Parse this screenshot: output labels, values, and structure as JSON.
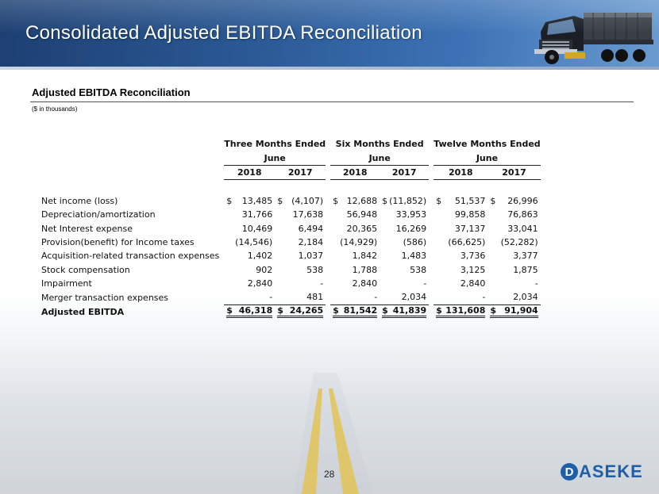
{
  "header": {
    "title": "Consolidated Adjusted EBITDA Reconciliation"
  },
  "section": {
    "title": "Adjusted EBITDA Reconciliation",
    "units": "($ in thousands)"
  },
  "table": {
    "groups": [
      {
        "line1": "Three Months Ended",
        "line2": "June"
      },
      {
        "line1": "Six Months Ended",
        "line2": "June"
      },
      {
        "line1": "Twelve Months Ended",
        "line2": "June"
      }
    ],
    "years": [
      "2018",
      "2017",
      "2018",
      "2017",
      "2018",
      "2017"
    ],
    "rows": [
      {
        "label": "Net income (loss)",
        "cells": [
          {
            "cur": "$",
            "val": "13,485"
          },
          {
            "cur": "$",
            "val": "(4,107)"
          },
          {
            "cur": "$",
            "val": "12,688"
          },
          {
            "cur": "$",
            "val": "(11,852)"
          },
          {
            "cur": "$",
            "val": "51,537"
          },
          {
            "cur": "$",
            "val": "26,996"
          }
        ]
      },
      {
        "label": "Depreciation/amortization",
        "cells": [
          {
            "cur": "",
            "val": "31,766"
          },
          {
            "cur": "",
            "val": "17,638"
          },
          {
            "cur": "",
            "val": "56,948"
          },
          {
            "cur": "",
            "val": "33,953"
          },
          {
            "cur": "",
            "val": "99,858"
          },
          {
            "cur": "",
            "val": "76,863"
          }
        ]
      },
      {
        "label": "Net Interest expense",
        "cells": [
          {
            "cur": "",
            "val": "10,469"
          },
          {
            "cur": "",
            "val": "6,494"
          },
          {
            "cur": "",
            "val": "20,365"
          },
          {
            "cur": "",
            "val": "16,269"
          },
          {
            "cur": "",
            "val": "37,137"
          },
          {
            "cur": "",
            "val": "33,041"
          }
        ]
      },
      {
        "label": "Provision(benefit) for Income taxes",
        "cells": [
          {
            "cur": "",
            "val": "(14,546)"
          },
          {
            "cur": "",
            "val": "2,184"
          },
          {
            "cur": "",
            "val": "(14,929)"
          },
          {
            "cur": "",
            "val": "(586)"
          },
          {
            "cur": "",
            "val": "(66,625)"
          },
          {
            "cur": "",
            "val": "(52,282)"
          }
        ]
      },
      {
        "label": "Acquisition-related transaction expenses",
        "cells": [
          {
            "cur": "",
            "val": "1,402"
          },
          {
            "cur": "",
            "val": "1,037"
          },
          {
            "cur": "",
            "val": "1,842"
          },
          {
            "cur": "",
            "val": "1,483"
          },
          {
            "cur": "",
            "val": "3,736"
          },
          {
            "cur": "",
            "val": "3,377"
          }
        ]
      },
      {
        "label": "Stock compensation",
        "cells": [
          {
            "cur": "",
            "val": "902"
          },
          {
            "cur": "",
            "val": "538"
          },
          {
            "cur": "",
            "val": "1,788"
          },
          {
            "cur": "",
            "val": "538"
          },
          {
            "cur": "",
            "val": "3,125"
          },
          {
            "cur": "",
            "val": "1,875"
          }
        ]
      },
      {
        "label": "Impairment",
        "cells": [
          {
            "cur": "",
            "val": "2,840"
          },
          {
            "cur": "",
            "val": "-"
          },
          {
            "cur": "",
            "val": "2,840"
          },
          {
            "cur": "",
            "val": "-"
          },
          {
            "cur": "",
            "val": "2,840"
          },
          {
            "cur": "",
            "val": "-"
          }
        ]
      },
      {
        "label": "Merger transaction expenses",
        "cells": [
          {
            "cur": "",
            "val": "-"
          },
          {
            "cur": "",
            "val": "481"
          },
          {
            "cur": "",
            "val": "-"
          },
          {
            "cur": "",
            "val": "2,034"
          },
          {
            "cur": "",
            "val": "-"
          },
          {
            "cur": "",
            "val": "2,034"
          }
        ]
      }
    ],
    "total": {
      "label": "Adjusted EBITDA",
      "cells": [
        {
          "cur": "$",
          "val": "46,318"
        },
        {
          "cur": "$",
          "val": "24,265"
        },
        {
          "cur": "$",
          "val": "81,542"
        },
        {
          "cur": "$",
          "val": "41,839"
        },
        {
          "cur": "$",
          "val": "131,608"
        },
        {
          "cur": "$",
          "val": "91,904"
        }
      ]
    }
  },
  "footer": {
    "page_number": "28",
    "logo_letter": "D",
    "logo_text": "ASEKE",
    "brand_color": "#1f5fa8"
  },
  "icons": {
    "truck": "truck-icon"
  }
}
